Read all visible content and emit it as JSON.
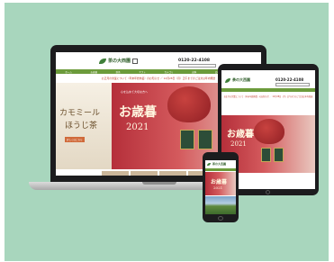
{
  "site": {
    "logo_text": "茶の大西園",
    "phone": "0120-22-4108",
    "notice": "お正月の営業について（年末年始休業）のお知らせ ／ 12月28日（月）正午までのご注文は年内発送",
    "nav": [
      "ホーム",
      "お歳暮",
      "新茶",
      "ギフト",
      "カテゴリ",
      "送料",
      "会社案内",
      "お問合せ"
    ]
  },
  "hero": {
    "title": "お歳暮",
    "year": "2021",
    "subtitle": "心を込めて大切な方へ"
  },
  "side_promo": {
    "line1": "カモミール",
    "line2": "ほうじ茶",
    "cta": "詳しくはこちら"
  },
  "colors": {
    "background": "#a8d6bd",
    "nav_green": "#6c9b3b",
    "hero_red": "#b52f3a",
    "device_black": "#1c1c1e"
  }
}
